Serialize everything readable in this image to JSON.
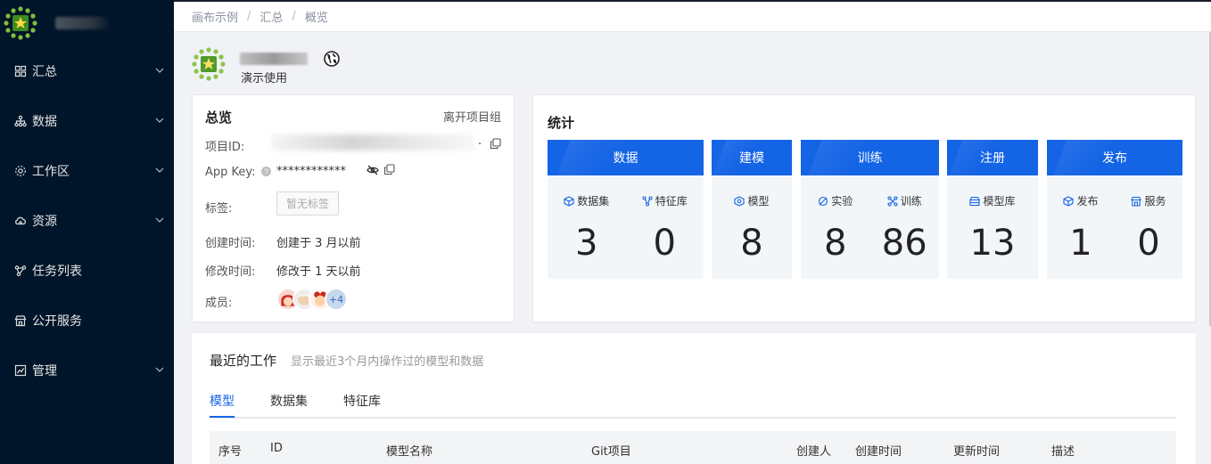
{
  "sidebar": {
    "items": [
      {
        "label": "汇总",
        "icon": "dashboard-icon",
        "has_arrow": true
      },
      {
        "label": "数据",
        "icon": "data-tree-icon",
        "has_arrow": true
      },
      {
        "label": "工作区",
        "icon": "workspace-gear-icon",
        "has_arrow": true
      },
      {
        "label": "资源",
        "icon": "cloud-resource-icon",
        "has_arrow": true
      },
      {
        "label": "任务列表",
        "icon": "task-graph-icon",
        "has_arrow": false
      },
      {
        "label": "公开服务",
        "icon": "public-service-icon",
        "has_arrow": false
      },
      {
        "label": "管理",
        "icon": "chart-manage-icon",
        "has_arrow": true
      }
    ]
  },
  "breadcrumb": {
    "items": [
      "画布示例",
      "汇总",
      "概览"
    ],
    "separator": "/"
  },
  "project": {
    "subtitle": "演示使用"
  },
  "overview": {
    "title": "总览",
    "leave_label": "离开项目组",
    "project_id_label": "项目ID:",
    "project_id_tail": ".",
    "app_key_label": "App Key:",
    "app_key_value": "************",
    "tags_label": "标签:",
    "tags_empty": "暂无标签",
    "created_label": "创建时间:",
    "created_value": "创建于 3 月以前",
    "modified_label": "修改时间:",
    "modified_value": "修改于 1 天以前",
    "members_label": "成员:",
    "members_more": "+4"
  },
  "stats": {
    "title": "统计",
    "groups": [
      {
        "title": "数据",
        "items": [
          {
            "label": "数据集",
            "icon": "cube-icon",
            "value": "3"
          },
          {
            "label": "特征库",
            "icon": "feature-icon",
            "value": "0"
          }
        ]
      },
      {
        "title": "建模",
        "items": [
          {
            "label": "模型",
            "icon": "model-icon",
            "value": "8"
          }
        ]
      },
      {
        "title": "训练",
        "items": [
          {
            "label": "实验",
            "icon": "experiment-icon",
            "value": "8"
          },
          {
            "label": "训练",
            "icon": "train-icon",
            "value": "86"
          }
        ]
      },
      {
        "title": "注册",
        "items": [
          {
            "label": "模型库",
            "icon": "model-registry-icon",
            "value": "13"
          }
        ]
      },
      {
        "title": "发布",
        "items": [
          {
            "label": "发布",
            "icon": "publish-icon",
            "value": "1"
          },
          {
            "label": "服务",
            "icon": "service-icon",
            "value": "0"
          }
        ]
      }
    ]
  },
  "recent": {
    "title": "最近的工作",
    "subtitle": "显示最近3个月内操作过的模型和数据",
    "tabs": [
      "模型",
      "数据集",
      "特征库"
    ],
    "active_tab": "模型",
    "columns": [
      "序号",
      "ID",
      "模型名称",
      "Git项目",
      "创建人",
      "创建时间",
      "更新时间",
      "描述"
    ]
  },
  "colors": {
    "sidebar_bg": "#001529",
    "accent": "#1464e6",
    "stat_bg": "#f3f6f9"
  }
}
